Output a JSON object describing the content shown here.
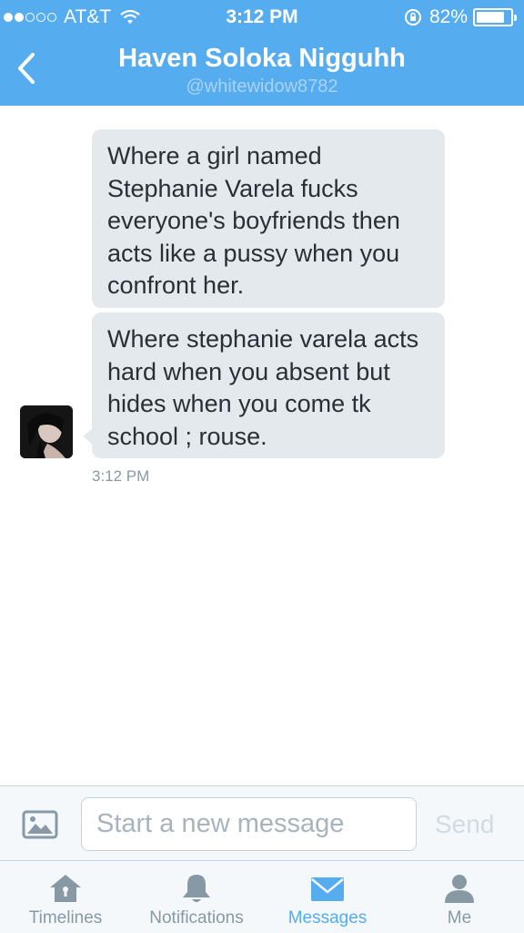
{
  "status_bar": {
    "carrier": "AT&T",
    "time": "3:12 PM",
    "battery": "82%",
    "battery_level": 0.82,
    "signal_bars_filled": 2,
    "signal_bars_total": 5
  },
  "header": {
    "title": "Haven Soloka Nigguhh",
    "handle": "@whitewidow8782",
    "back_icon": "chevron-left-icon"
  },
  "conversation": {
    "messages": [
      {
        "text": "Where a girl named Stephanie Varela fucks everyone's boyfriends then acts like a pussy when you confront her."
      },
      {
        "text": "Where stephanie varela acts hard when you absent but hides when you come tk school ; rouse."
      }
    ],
    "timestamp": "3:12 PM"
  },
  "composer": {
    "placeholder": "Start a new message",
    "value": "",
    "send_label": "Send"
  },
  "tabs": [
    {
      "label": "Timelines",
      "icon": "home-icon",
      "active": false
    },
    {
      "label": "Notifications",
      "icon": "bell-icon",
      "active": false
    },
    {
      "label": "Messages",
      "icon": "envelope-icon",
      "active": true
    },
    {
      "label": "Me",
      "icon": "person-icon",
      "active": false
    }
  ],
  "colors": {
    "accent": "#55acee",
    "bubble": "#e4e9ee",
    "muted": "#8899a6"
  }
}
